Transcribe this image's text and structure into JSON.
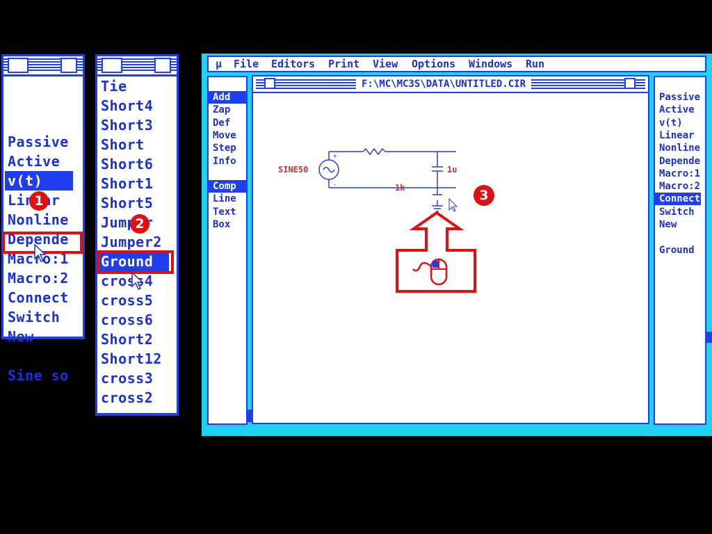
{
  "left_menu_1": {
    "items": [
      "Passive",
      "Active",
      "v(t)",
      "Linear",
      "Nonline",
      "Depende",
      "Macro:1",
      "Macro:2",
      "Connect",
      "Switch",
      "New",
      "",
      "Sine so"
    ],
    "selected": "v(t)",
    "highlighted": "Connect"
  },
  "left_menu_2": {
    "items": [
      "Tie",
      "Short4",
      "Short3",
      "Short",
      "Short6",
      "Short1",
      "Short5",
      "Jumper",
      "Jumper2",
      "Ground",
      "cross4",
      "cross5",
      "cross6",
      "Short2",
      "Short12",
      "cross3",
      "cross2"
    ],
    "selected": "Ground",
    "highlighted": "Ground"
  },
  "steps": {
    "one": "1",
    "two": "2",
    "three": "3"
  },
  "menubar": {
    "mu": "µ",
    "items": [
      "File",
      "Editors",
      "Print",
      "View",
      "Options",
      "Windows",
      "Run"
    ]
  },
  "tools": {
    "items": [
      "Add",
      "Zap",
      "Def",
      "Move",
      "Step",
      "Info",
      "",
      "Comp",
      "Line",
      "Text",
      "Box"
    ],
    "selected": [
      "Add",
      "Comp"
    ]
  },
  "schematic": {
    "title": "F:\\MC\\MC3S\\DATA\\UNTITLED.CIR",
    "source_label": "SINE50",
    "cap_label": "1u",
    "res_label": "1k"
  },
  "right_panel": {
    "items": [
      "Passive",
      "Active",
      "v(t)",
      "Linear",
      "Nonline",
      "Depende",
      "Macro:1",
      "Macro:2",
      "Connect",
      "Switch",
      "New",
      "",
      "Ground"
    ],
    "selected": "Connect"
  },
  "colors": {
    "accent": "#1e3ef0",
    "highlight": "#e01010",
    "window_bg": "#22d0f0"
  }
}
